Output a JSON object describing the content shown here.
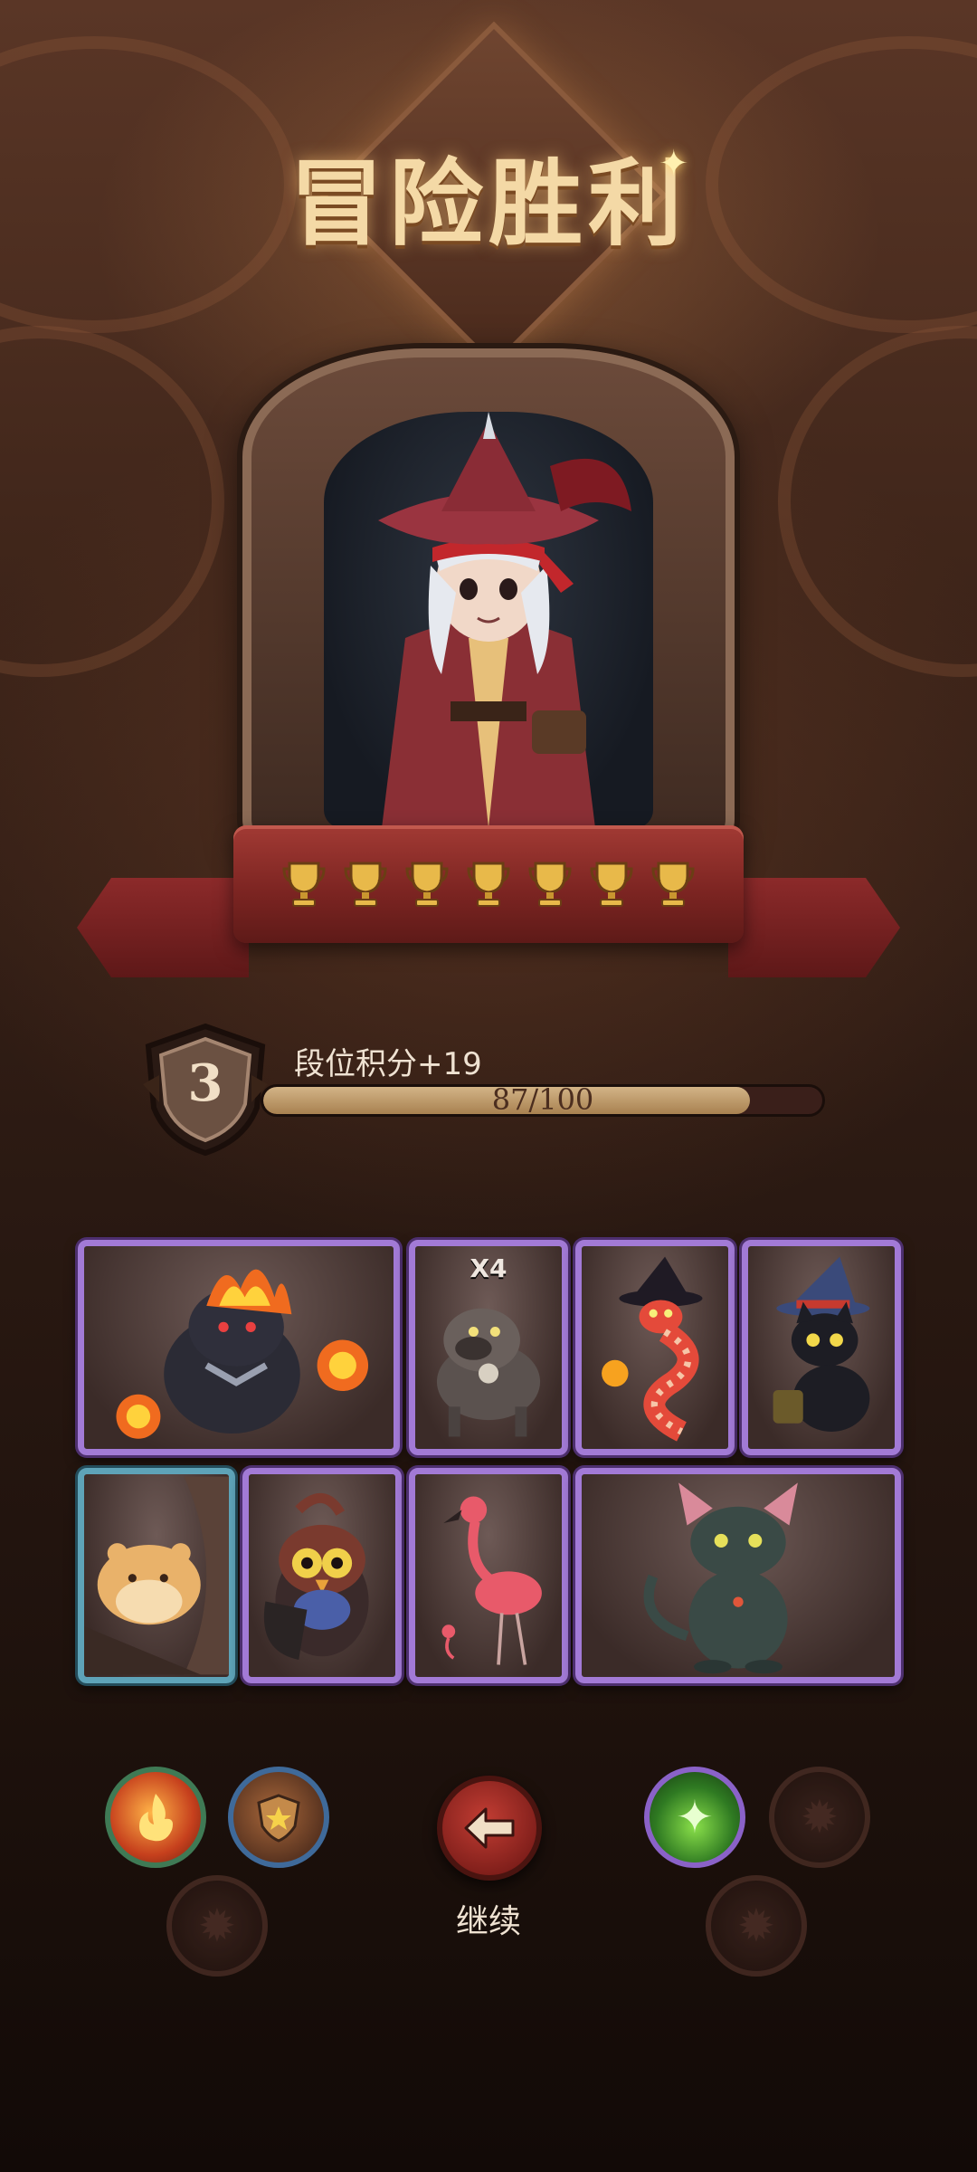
{
  "header": {
    "title": "冒险胜利"
  },
  "hero": {
    "trophy_count": 7
  },
  "rank": {
    "level": "3",
    "points_label": "段位积分+19",
    "progress_text": "87/100",
    "progress_current": 87,
    "progress_max": 100
  },
  "cards": [
    {
      "id": "fire-bear",
      "badge": "",
      "rarity": "purple"
    },
    {
      "id": "dog",
      "badge": "X4",
      "rarity": "purple"
    },
    {
      "id": "witch-snake",
      "badge": "",
      "rarity": "purple"
    },
    {
      "id": "witch-cat",
      "badge": "",
      "rarity": "purple"
    },
    {
      "id": "hamster",
      "badge": "",
      "rarity": "blue"
    },
    {
      "id": "owl",
      "badge": "",
      "rarity": "purple"
    },
    {
      "id": "flamingo",
      "badge": "",
      "rarity": "purple"
    },
    {
      "id": "sphynx-cat",
      "badge": "",
      "rarity": "purple"
    }
  ],
  "footer": {
    "continue_label": "继续"
  },
  "colors": {
    "accent_gold": "#f4d9a6",
    "ribbon_red": "#a23a34",
    "card_purple": "#a27ad6",
    "card_blue": "#5ea3b8"
  }
}
